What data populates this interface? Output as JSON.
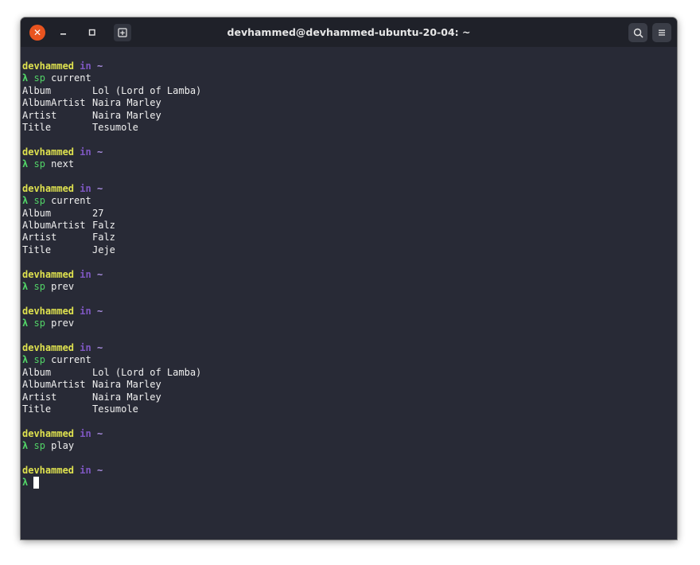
{
  "window": {
    "title": "devhammed@devhammed-ubuntu-20-04: ~",
    "close_glyph": "✕",
    "min_glyph": "–",
    "max_glyph": "□"
  },
  "prompt": {
    "user": "devhammed",
    "in": "in",
    "dir": "~",
    "symbol": "λ"
  },
  "colors": {
    "background": "#282a36",
    "user": "#dfe24f",
    "in": "#7e57c2",
    "lambda": "#52d467",
    "close": "#e9541f"
  },
  "blocks": [
    {
      "command": "sp",
      "arg": "current",
      "output": [
        {
          "key": "Album",
          "value": "Lol (Lord of Lamba)"
        },
        {
          "key": "AlbumArtist",
          "value": "Naira Marley"
        },
        {
          "key": "Artist",
          "value": "Naira Marley"
        },
        {
          "key": "Title",
          "value": "Tesumole"
        }
      ]
    },
    {
      "command": "sp",
      "arg": "next",
      "output": []
    },
    {
      "command": "sp",
      "arg": "current",
      "output": [
        {
          "key": "Album",
          "value": "27"
        },
        {
          "key": "AlbumArtist",
          "value": "Falz"
        },
        {
          "key": "Artist",
          "value": "Falz"
        },
        {
          "key": "Title",
          "value": "Jeje"
        }
      ]
    },
    {
      "command": "sp",
      "arg": "prev",
      "output": []
    },
    {
      "command": "sp",
      "arg": "prev",
      "output": []
    },
    {
      "command": "sp",
      "arg": "current",
      "output": [
        {
          "key": "Album",
          "value": "Lol (Lord of Lamba)"
        },
        {
          "key": "AlbumArtist",
          "value": "Naira Marley"
        },
        {
          "key": "Artist",
          "value": "Naira Marley"
        },
        {
          "key": "Title",
          "value": "Tesumole"
        }
      ]
    },
    {
      "command": "sp",
      "arg": "play",
      "output": []
    }
  ]
}
